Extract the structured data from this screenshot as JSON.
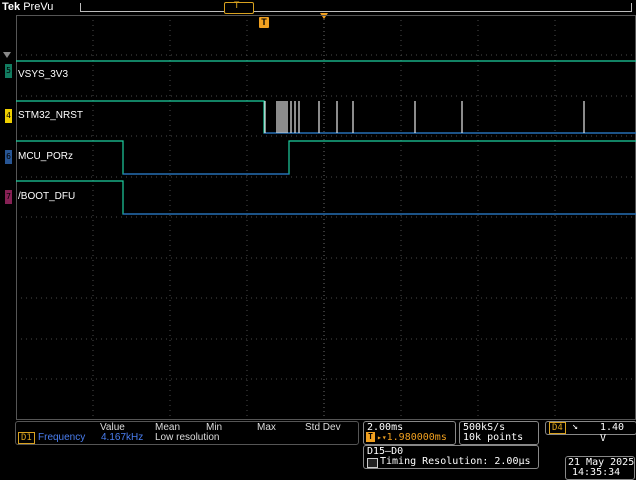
{
  "header": {
    "brand_prefix": "Tek",
    "mode": "PreVu"
  },
  "trigger_marker": "T",
  "channels": [
    {
      "label": "VSYS_3V3",
      "tag": "5",
      "color": "#1ecfa0"
    },
    {
      "label": "STM32_NRST",
      "tag": "4",
      "color": "#f0d000"
    },
    {
      "label": "MCU_PORz",
      "tag": "6",
      "color": "#3a7bd5"
    },
    {
      "label": "/BOOT_DFU",
      "tag": "7",
      "color": "#c0307a"
    }
  ],
  "measurement": {
    "headers": {
      "value": "Value",
      "mean": "Mean",
      "min": "Min",
      "max": "Max",
      "std_dev": "Std Dev"
    },
    "source": "D1",
    "name": "Frequency",
    "value": "4.167kHz",
    "note": "Low resolution"
  },
  "horizontal": {
    "scale": "2.00ms",
    "trigger_delay": "1.980000ms",
    "trigger_symbol": "T"
  },
  "acquisition": {
    "sample_rate": "500kS/s",
    "record_length": "10k points"
  },
  "trigger": {
    "source": "D4",
    "slope_symbol": "↘",
    "level": "1.40 V"
  },
  "bus": {
    "name": "D15–D0",
    "timing": "Timing Resolution: 2.00µs"
  },
  "datetime": {
    "date": "21 May 2025",
    "time": "14:35:34"
  },
  "colors": {
    "graticule": "#4a4a4a",
    "accent": "#f0a020",
    "signal_line": "#1ecfa0",
    "signal_low": "#2a66c0"
  }
}
